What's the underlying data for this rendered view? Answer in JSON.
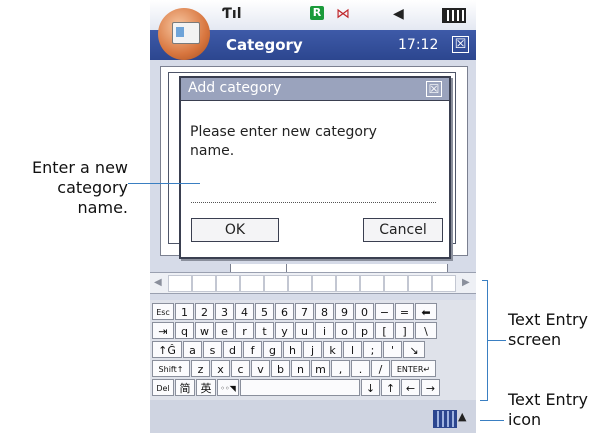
{
  "status_bar": {
    "signal_icon": "signal-strength-icon",
    "r_badge": "R",
    "message_icon": "message-icon",
    "volume_icon": "volume-icon",
    "battery_icon": "battery-icon"
  },
  "title_bar": {
    "title": "Category",
    "time": "17:12",
    "close_symbol": "☒"
  },
  "dialog": {
    "title": "Add category",
    "close_symbol": "☒",
    "message": "Please enter new category name.",
    "ok_label": "OK",
    "cancel_label": "Cancel"
  },
  "keyboard": {
    "rows": [
      [
        "Esc",
        "1",
        "2",
        "3",
        "4",
        "5",
        "6",
        "7",
        "8",
        "9",
        "0",
        "−",
        "=",
        "⬅"
      ],
      [
        "⇥",
        "q",
        "w",
        "e",
        "r",
        "t",
        "y",
        "u",
        "i",
        "o",
        "p",
        "[",
        "]",
        "\\"
      ],
      [
        "↑Ĝ",
        "a",
        "s",
        "d",
        "f",
        "g",
        "h",
        "j",
        "k",
        "l",
        ";",
        "'",
        "↘"
      ],
      [
        "Shift↑",
        "z",
        "x",
        "c",
        "v",
        "b",
        "n",
        "m",
        ",",
        ".",
        "/",
        "ENTER↵"
      ],
      [
        "Del",
        "简",
        "英",
        "◦◦◥",
        "",
        "↓",
        "↑",
        "←",
        "→"
      ]
    ]
  },
  "annotations": {
    "enter_line1": "Enter a new",
    "enter_line2": "category",
    "enter_line3": "name.",
    "screen_line1": "Text Entry",
    "screen_line2": "screen",
    "icon_line1": "Text Entry",
    "icon_line2": "icon"
  },
  "colors": {
    "title_bar": "#2c468f",
    "dialog_title": "#9aa3bd",
    "annotation_line": "#3a7fc2"
  }
}
